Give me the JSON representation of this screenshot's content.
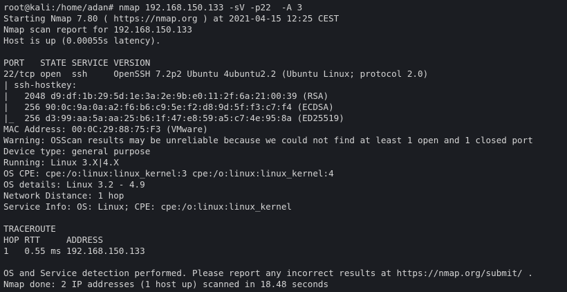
{
  "terminal": {
    "lines": [
      "root@kali:/home/adan# nmap 192.168.150.133 -sV -p22  -A 3",
      "Starting Nmap 7.80 ( https://nmap.org ) at 2021-04-15 12:25 CEST",
      "Nmap scan report for 192.168.150.133",
      "Host is up (0.00055s latency).",
      "",
      "PORT   STATE SERVICE VERSION",
      "22/tcp open  ssh     OpenSSH 7.2p2 Ubuntu 4ubuntu2.2 (Ubuntu Linux; protocol 2.0)",
      "| ssh-hostkey: ",
      "|   2048 d9:df:1b:29:5d:1e:3a:2e:9b:e0:11:2f:6a:21:00:39 (RSA)",
      "|   256 90:0c:9a:0a:a2:f6:b6:c9:5e:f2:d8:9d:5f:f3:c7:f4 (ECDSA)",
      "|_  256 d3:99:aa:5a:aa:25:b6:1f:47:e8:59:a5:c7:4e:95:8a (ED25519)",
      "MAC Address: 00:0C:29:88:75:F3 (VMware)",
      "Warning: OSScan results may be unreliable because we could not find at least 1 open and 1 closed port",
      "Device type: general purpose",
      "Running: Linux 3.X|4.X",
      "OS CPE: cpe:/o:linux:linux_kernel:3 cpe:/o:linux:linux_kernel:4",
      "OS details: Linux 3.2 - 4.9",
      "Network Distance: 1 hop",
      "Service Info: OS: Linux; CPE: cpe:/o:linux:linux_kernel",
      "",
      "TRACEROUTE",
      "HOP RTT     ADDRESS",
      "1   0.55 ms 192.168.150.133",
      "",
      "OS and Service detection performed. Please report any incorrect results at https://nmap.org/submit/ .",
      "Nmap done: 2 IP addresses (1 host up) scanned in 18.48 seconds"
    ]
  }
}
